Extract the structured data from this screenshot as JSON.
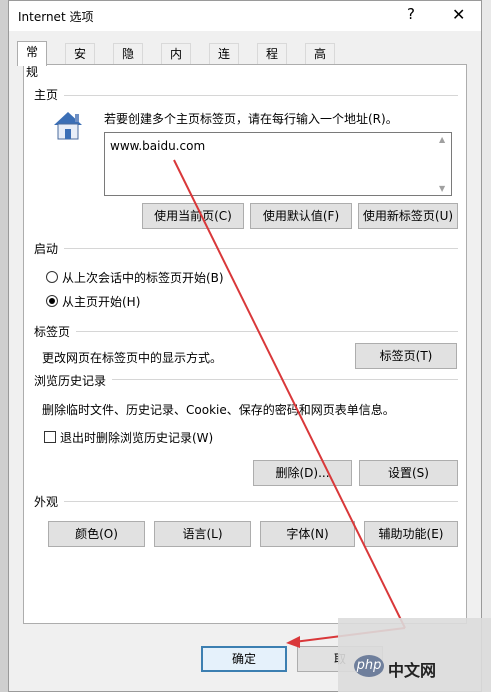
{
  "window": {
    "title": "Internet 选项",
    "help": "?",
    "close": "✕"
  },
  "tabs": [
    "常规",
    "安全",
    "隐私",
    "内容",
    "连接",
    "程序",
    "高级"
  ],
  "home": {
    "group_title": "主页",
    "description": "若要创建多个主页标签页，请在每行输入一个地址(R)。",
    "url": "www.baidu.com",
    "buttons": {
      "use_current": "使用当前页(C)",
      "use_default": "使用默认值(F)",
      "use_new_tab": "使用新标签页(U)"
    }
  },
  "startup": {
    "group_title": "启动",
    "options": [
      {
        "label": "从上次会话中的标签页开始(B)",
        "selected": false
      },
      {
        "label": "从主页开始(H)",
        "selected": true
      }
    ]
  },
  "tabs_group": {
    "group_title": "标签页",
    "description": "更改网页在标签页中的显示方式。",
    "button": "标签页(T)"
  },
  "history": {
    "group_title": "浏览历史记录",
    "description": "删除临时文件、历史记录、Cookie、保存的密码和网页表单信息。",
    "checkbox_label": "退出时删除浏览历史记录(W)",
    "checkbox_checked": false,
    "delete_button": "删除(D)...",
    "settings_button": "设置(S)"
  },
  "appearance": {
    "group_title": "外观",
    "buttons": [
      "颜色(O)",
      "语言(L)",
      "字体(N)",
      "辅助功能(E)"
    ]
  },
  "footer": {
    "ok": "确定",
    "cancel": "取"
  },
  "watermark": {
    "logo": "php",
    "text": "中文网"
  },
  "colors": {
    "accent": "#3c7fb1",
    "arrow": "#d9383a"
  }
}
